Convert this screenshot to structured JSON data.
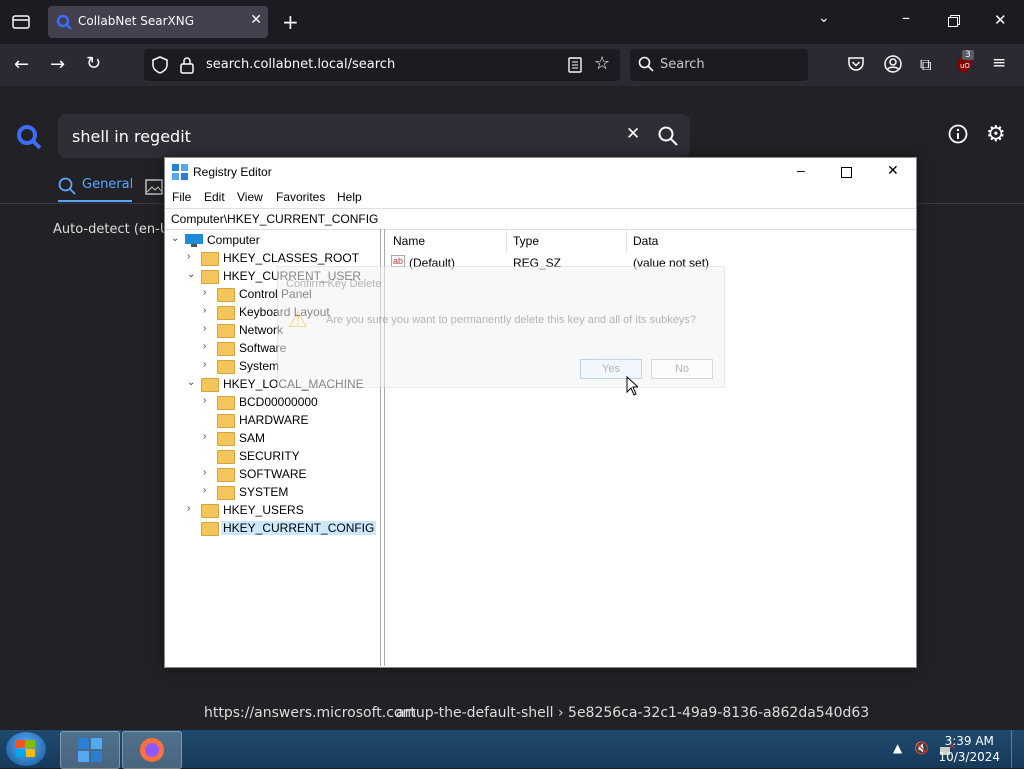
{
  "browser": {
    "tab_title": "CollabNet SearXNG",
    "url": "search.collabnet.local/search",
    "search_placeholder": "Search",
    "extension_badge": "3"
  },
  "page": {
    "query": "shell in regedit",
    "category_general": "General",
    "autodetect": "Auto-detect (en-US",
    "result_url_a": "https://answers.microsoft.com",
    "result_url_b": "artup-the-default-shell › 5e8256ca-32c1-49a9-8136-a862da540d63"
  },
  "regedit": {
    "title": "Registry Editor",
    "menu": [
      "File",
      "Edit",
      "View",
      "Favorites",
      "Help"
    ],
    "address": "Computer\\HKEY_CURRENT_CONFIG",
    "tree": [
      "Computer",
      "HKEY_CLASSES_ROOT",
      "HKEY_CURRENT_USER",
      "Control Panel",
      "Keyboard Layout",
      "Network",
      "Software",
      "System",
      "HKEY_LOCAL_MACHINE",
      "BCD00000000",
      "HARDWARE",
      "SAM",
      "SECURITY",
      "SOFTWARE",
      "SYSTEM",
      "HKEY_USERS",
      "HKEY_CURRENT_CONFIG"
    ],
    "columns": [
      "Name",
      "Type",
      "Data"
    ],
    "values": [
      {
        "name": "(Default)",
        "type": "REG_SZ",
        "data": "(value not set)"
      }
    ]
  },
  "dialog": {
    "title": "Confirm Key Delete",
    "message": "Are you sure you want to permanently delete this key and all of its subkeys?",
    "yes": "Yes",
    "no": "No"
  },
  "taskbar": {
    "time": "3:39 AM",
    "date": "10/3/2024"
  }
}
